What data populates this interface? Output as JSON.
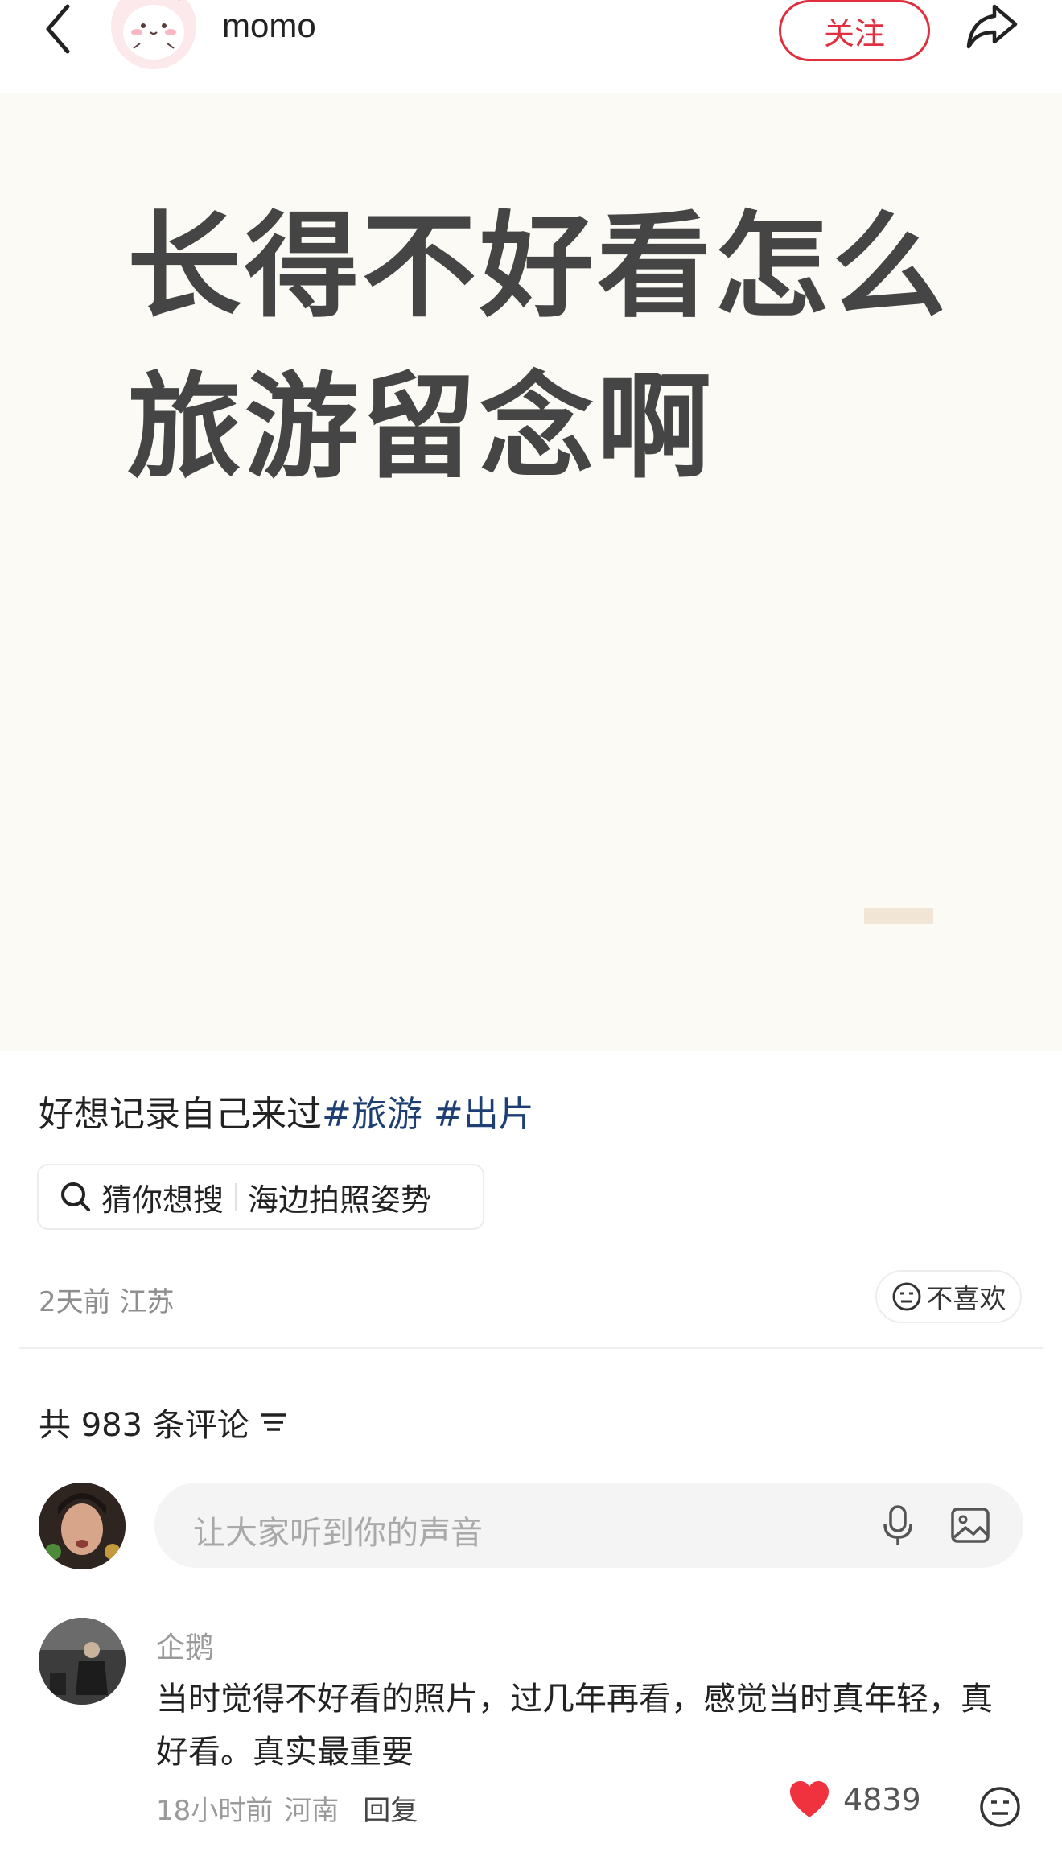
{
  "header": {
    "username": "momo",
    "follow_label": "关注",
    "icons": [
      "chevron-left-icon",
      "share-icon"
    ]
  },
  "post": {
    "cover_title": "长得不好看怎么旅游留念啊",
    "caption_text": "好想记录自己来过",
    "hashtags": [
      "#旅游",
      "#出片"
    ],
    "search_label": "猜你想搜",
    "search_query": "海边拍照姿势",
    "time": "2天前",
    "location": "江苏",
    "dislike_label": "不喜欢"
  },
  "comments": {
    "count_text": "共 983 条评论",
    "input_placeholder": "让大家听到你的声音",
    "items": [
      {
        "user": "企鹅",
        "text": "当时觉得不好看的照片，过几年再看，感觉当时真年轻，真好看。真实最重要",
        "time": "18小时前",
        "location": "河南",
        "reply_label": "回复",
        "likes": "4839"
      }
    ]
  },
  "colors": {
    "accent_red": "#e0303f",
    "hashtag_blue": "#1e3f74",
    "cover_bg": "#fcfaf5",
    "cover_text": "#454545"
  }
}
